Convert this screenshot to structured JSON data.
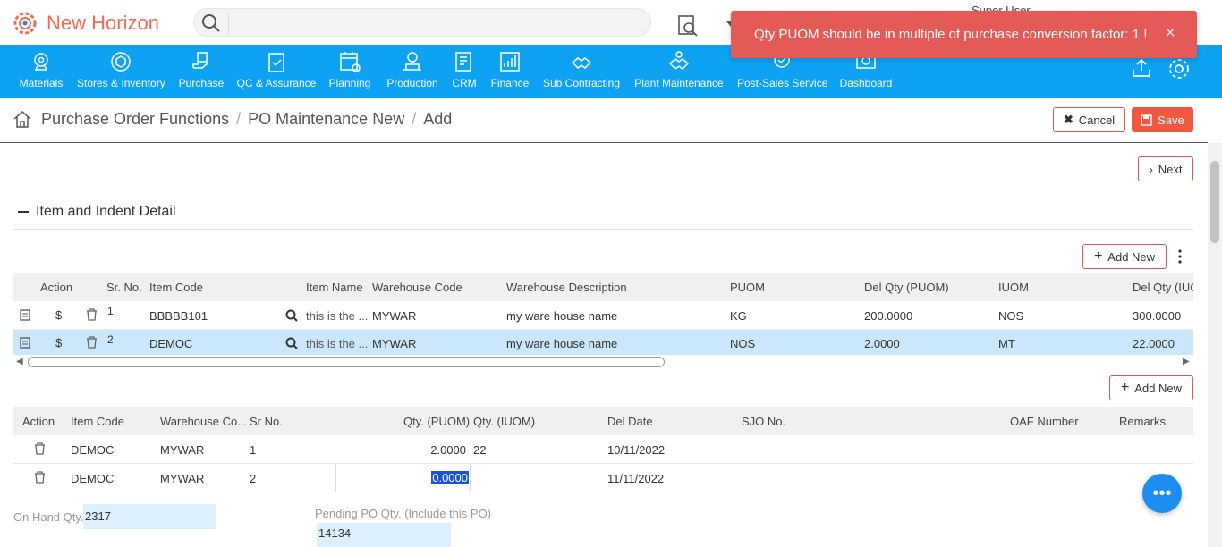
{
  "app": {
    "name": "New Horizon",
    "user": "Super User"
  },
  "search": {
    "placeholder": ""
  },
  "toast": {
    "message": "Qty PUOM should be in multiple of purchase conversion factor: 1 !",
    "close": "×"
  },
  "nav": [
    {
      "label": "Materials",
      "icon": "materials-icon"
    },
    {
      "label": "Stores & Inventory",
      "icon": "stores-icon"
    },
    {
      "label": "Purchase",
      "icon": "purchase-icon"
    },
    {
      "label": "QC & Assurance",
      "icon": "qc-icon"
    },
    {
      "label": "Planning",
      "icon": "planning-icon"
    },
    {
      "label": "Production",
      "icon": "production-icon"
    },
    {
      "label": "CRM",
      "icon": "crm-icon"
    },
    {
      "label": "Finance",
      "icon": "finance-icon"
    },
    {
      "label": "Sub Contracting",
      "icon": "subcontracting-icon"
    },
    {
      "label": "Plant Maintenance",
      "icon": "maintenance-icon"
    },
    {
      "label": "Post-Sales Service",
      "icon": "postsales-icon"
    },
    {
      "label": "Dashboard",
      "icon": "dashboard-icon"
    }
  ],
  "breadcrumb": [
    "Purchase Order Functions",
    "PO Maintenance New",
    "Add"
  ],
  "buttons": {
    "cancel": "Cancel",
    "save": "Save",
    "next": "Next",
    "add_new": "Add New",
    "add_new2": "Add New"
  },
  "section": {
    "title": "Item and Indent Detail"
  },
  "table1": {
    "headers": [
      "Action",
      "Sr. No.",
      "Item Code",
      "Item Name",
      "Warehouse Code",
      "Warehouse Description",
      "PUOM",
      "Del Qty (PUOM)",
      "IUOM",
      "Del Qty (IUC"
    ],
    "rows": [
      {
        "sr": "1",
        "item_code": "BBBBB101",
        "item_name": "this is the ...",
        "wh_code": "MYWAR",
        "wh_desc": "my ware house name",
        "puom": "KG",
        "del_qty_puom": "200.0000",
        "iuom": "NOS",
        "del_qty_iuom": "300.0000"
      },
      {
        "sr": "2",
        "item_code": "DEMOC",
        "item_name": "this is the ...",
        "wh_code": "MYWAR",
        "wh_desc": "my ware house name",
        "puom": "NOS",
        "del_qty_puom": "2.0000",
        "iuom": "MT",
        "del_qty_iuom": "22.0000"
      }
    ]
  },
  "table2": {
    "headers": [
      "Action",
      "Item Code",
      "Warehouse Co...",
      "Sr No.",
      "Qty. (PUOM)",
      "Qty. (IUOM)",
      "Del Date",
      "SJO No.",
      "OAF Number",
      "Remarks"
    ],
    "rows": [
      {
        "item_code": "DEMOC",
        "wh": "MYWAR",
        "sr": "1",
        "qty_puom": "2.0000",
        "qty_iuom": "22",
        "del_date": "10/11/2022"
      },
      {
        "item_code": "DEMOC",
        "wh": "MYWAR",
        "sr": "2",
        "qty_puom": "0.0000",
        "qty_iuom": "",
        "del_date": "11/11/2022"
      }
    ]
  },
  "fields": {
    "on_hand_label": "On Hand Qty.",
    "on_hand_value": "2317",
    "pending_label": "Pending PO Qty. (Include this PO)",
    "pending_value": "14134"
  },
  "colors": {
    "nav": "#0ea2f2",
    "accent": "#f26b4f",
    "toast": "#e35a57",
    "selected_row": "#cbe7fb"
  }
}
